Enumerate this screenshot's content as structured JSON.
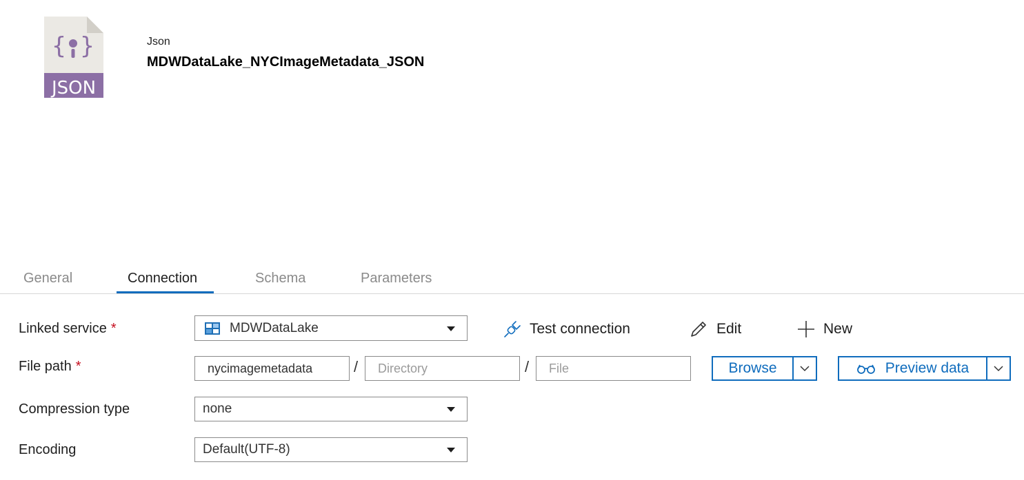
{
  "header": {
    "dataset_type": "Json",
    "dataset_name": "MDWDataLake_NYCImageMetadata_JSON",
    "file_icon_label": "JSON",
    "file_icon_color": "#8c6fa5"
  },
  "tabs": [
    {
      "label": "General",
      "active": false
    },
    {
      "label": "Connection",
      "active": true
    },
    {
      "label": "Schema",
      "active": false
    },
    {
      "label": "Parameters",
      "active": false
    }
  ],
  "form": {
    "linked_service": {
      "label": "Linked service",
      "required_mark": "*",
      "value": "MDWDataLake"
    },
    "file_path": {
      "label": "File path",
      "required_mark": "*",
      "container_value": "nycimagemetadata",
      "directory_placeholder": "Directory",
      "file_placeholder": "File",
      "separator": "/"
    },
    "compression_type": {
      "label": "Compression type",
      "value": "none"
    },
    "encoding": {
      "label": "Encoding",
      "value": "Default(UTF-8)"
    }
  },
  "actions": {
    "test_connection": "Test connection",
    "edit": "Edit",
    "new": "New",
    "browse": "Browse",
    "preview_data": "Preview data"
  },
  "colors": {
    "accent": "#0f6cbd",
    "required": "#c50f1f"
  }
}
